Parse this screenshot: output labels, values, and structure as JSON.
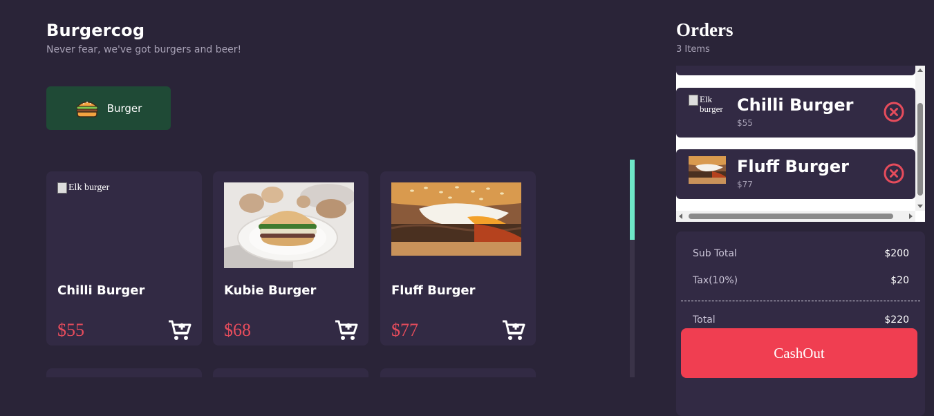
{
  "header": {
    "brand": "Burgercog",
    "tagline": "Never fear, we've got burgers and beer!"
  },
  "categories": [
    {
      "label": "Burger",
      "icon": "burger-icon",
      "color": "#1f4a36"
    }
  ],
  "menu": [
    {
      "name": "Chilli Burger",
      "price": "$55",
      "image_alt": "Elk burger",
      "image_broken": true
    },
    {
      "name": "Kubie Burger",
      "price": "$68",
      "image_alt": ""
    },
    {
      "name": "Fluff Burger",
      "price": "$77",
      "image_alt": ""
    }
  ],
  "orders": {
    "title": "Orders",
    "count_label": "3 Items",
    "items": [
      {
        "name": "Chilli Burger",
        "price": "$55",
        "image_alt": "Elk burger",
        "image_broken": true
      },
      {
        "name": "Fluff Burger",
        "price": "$77"
      }
    ]
  },
  "summary": {
    "subtotal_label": "Sub Total",
    "subtotal": "$200",
    "tax_label": "Tax(10%)",
    "tax": "$20",
    "total_label": "Total",
    "total": "$220",
    "cashout_label": "CashOut"
  },
  "colors": {
    "background": "#2a2438",
    "card": "#322a44",
    "accent": "#f03e51",
    "price": "#e64c5c",
    "scroll_accent": "#6ee7c8"
  }
}
